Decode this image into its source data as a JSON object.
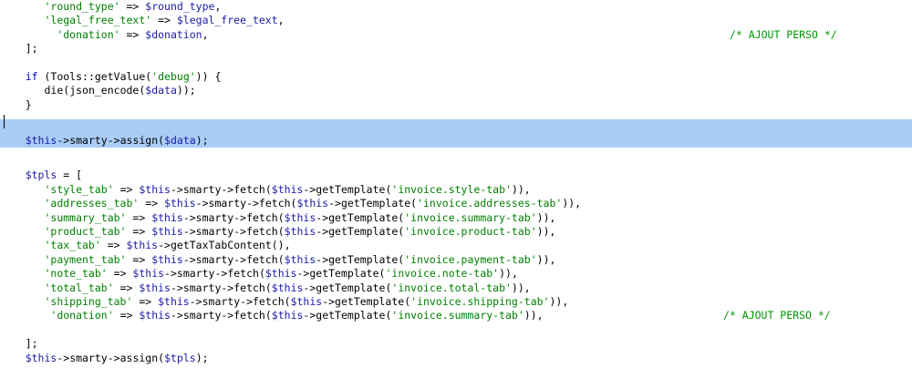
{
  "editor": {
    "lines": [
      {
        "indent": "       ",
        "parts": [
          [
            "str",
            "'round_type'"
          ],
          [
            "op",
            " => "
          ],
          [
            "var",
            "$round_type"
          ],
          [
            "op",
            ","
          ]
        ]
      },
      {
        "indent": "       ",
        "parts": [
          [
            "str",
            "'legal_free_text'"
          ],
          [
            "op",
            " => "
          ],
          [
            "var",
            "$legal_free_text"
          ],
          [
            "op",
            ","
          ]
        ]
      },
      {
        "indent": "         ",
        "parts": [
          [
            "str",
            "'donation'"
          ],
          [
            "op",
            " => "
          ],
          [
            "var",
            "$donation"
          ],
          [
            "op",
            ","
          ]
        ]
      },
      {
        "indent": "    ",
        "parts": [
          [
            "op",
            "];"
          ]
        ]
      },
      {
        "indent": "",
        "parts": []
      },
      {
        "indent": "    ",
        "parts": [
          [
            "kw",
            "if"
          ],
          [
            "op",
            " (Tools::"
          ],
          [
            "fn",
            "getValue"
          ],
          [
            "op",
            "("
          ],
          [
            "str",
            "'debug'"
          ],
          [
            "op",
            ")) {"
          ]
        ]
      },
      {
        "indent": "       ",
        "parts": [
          [
            "fn",
            "die"
          ],
          [
            "op",
            "("
          ],
          [
            "fn",
            "json_encode"
          ],
          [
            "op",
            "("
          ],
          [
            "var",
            "$data"
          ],
          [
            "op",
            "));"
          ]
        ]
      },
      {
        "indent": "    ",
        "parts": [
          [
            "op",
            "}"
          ]
        ]
      },
      {
        "indent": "",
        "parts": []
      },
      {
        "indent": "    ",
        "parts": [
          [
            "var",
            "$this"
          ],
          [
            "op",
            "->"
          ],
          [
            "fn",
            "smarty"
          ],
          [
            "op",
            "->"
          ],
          [
            "fn",
            "assign"
          ],
          [
            "op",
            "("
          ],
          [
            "var",
            "$data"
          ],
          [
            "op",
            ");"
          ]
        ],
        "selected": true
      },
      {
        "indent": "",
        "parts": []
      },
      {
        "indent": "    ",
        "parts": [
          [
            "var",
            "$tpls"
          ],
          [
            "op",
            " = ["
          ]
        ]
      },
      {
        "indent": "       ",
        "parts": [
          [
            "str",
            "'style_tab'"
          ],
          [
            "op",
            " => "
          ],
          [
            "var",
            "$this"
          ],
          [
            "op",
            "->"
          ],
          [
            "fn",
            "smarty"
          ],
          [
            "op",
            "->"
          ],
          [
            "fn",
            "fetch"
          ],
          [
            "op",
            "("
          ],
          [
            "var",
            "$this"
          ],
          [
            "op",
            "->"
          ],
          [
            "fn",
            "getTemplate"
          ],
          [
            "op",
            "("
          ],
          [
            "str",
            "'invoice.style-tab'"
          ],
          [
            "op",
            ")),"
          ]
        ]
      },
      {
        "indent": "       ",
        "parts": [
          [
            "str",
            "'addresses_tab'"
          ],
          [
            "op",
            " => "
          ],
          [
            "var",
            "$this"
          ],
          [
            "op",
            "->"
          ],
          [
            "fn",
            "smarty"
          ],
          [
            "op",
            "->"
          ],
          [
            "fn",
            "fetch"
          ],
          [
            "op",
            "("
          ],
          [
            "var",
            "$this"
          ],
          [
            "op",
            "->"
          ],
          [
            "fn",
            "getTemplate"
          ],
          [
            "op",
            "("
          ],
          [
            "str",
            "'invoice.addresses-tab'"
          ],
          [
            "op",
            ")),"
          ]
        ]
      },
      {
        "indent": "       ",
        "parts": [
          [
            "str",
            "'summary_tab'"
          ],
          [
            "op",
            " => "
          ],
          [
            "var",
            "$this"
          ],
          [
            "op",
            "->"
          ],
          [
            "fn",
            "smarty"
          ],
          [
            "op",
            "->"
          ],
          [
            "fn",
            "fetch"
          ],
          [
            "op",
            "("
          ],
          [
            "var",
            "$this"
          ],
          [
            "op",
            "->"
          ],
          [
            "fn",
            "getTemplate"
          ],
          [
            "op",
            "("
          ],
          [
            "str",
            "'invoice.summary-tab'"
          ],
          [
            "op",
            ")),"
          ]
        ]
      },
      {
        "indent": "       ",
        "parts": [
          [
            "str",
            "'product_tab'"
          ],
          [
            "op",
            " => "
          ],
          [
            "var",
            "$this"
          ],
          [
            "op",
            "->"
          ],
          [
            "fn",
            "smarty"
          ],
          [
            "op",
            "->"
          ],
          [
            "fn",
            "fetch"
          ],
          [
            "op",
            "("
          ],
          [
            "var",
            "$this"
          ],
          [
            "op",
            "->"
          ],
          [
            "fn",
            "getTemplate"
          ],
          [
            "op",
            "("
          ],
          [
            "str",
            "'invoice.product-tab'"
          ],
          [
            "op",
            ")),"
          ]
        ]
      },
      {
        "indent": "       ",
        "parts": [
          [
            "str",
            "'tax_tab'"
          ],
          [
            "op",
            " => "
          ],
          [
            "var",
            "$this"
          ],
          [
            "op",
            "->"
          ],
          [
            "fn",
            "getTaxTabContent"
          ],
          [
            "op",
            "(),"
          ]
        ]
      },
      {
        "indent": "       ",
        "parts": [
          [
            "str",
            "'payment_tab'"
          ],
          [
            "op",
            " => "
          ],
          [
            "var",
            "$this"
          ],
          [
            "op",
            "->"
          ],
          [
            "fn",
            "smarty"
          ],
          [
            "op",
            "->"
          ],
          [
            "fn",
            "fetch"
          ],
          [
            "op",
            "("
          ],
          [
            "var",
            "$this"
          ],
          [
            "op",
            "->"
          ],
          [
            "fn",
            "getTemplate"
          ],
          [
            "op",
            "("
          ],
          [
            "str",
            "'invoice.payment-tab'"
          ],
          [
            "op",
            ")),"
          ]
        ]
      },
      {
        "indent": "       ",
        "parts": [
          [
            "str",
            "'note_tab'"
          ],
          [
            "op",
            " => "
          ],
          [
            "var",
            "$this"
          ],
          [
            "op",
            "->"
          ],
          [
            "fn",
            "smarty"
          ],
          [
            "op",
            "->"
          ],
          [
            "fn",
            "fetch"
          ],
          [
            "op",
            "("
          ],
          [
            "var",
            "$this"
          ],
          [
            "op",
            "->"
          ],
          [
            "fn",
            "getTemplate"
          ],
          [
            "op",
            "("
          ],
          [
            "str",
            "'invoice.note-tab'"
          ],
          [
            "op",
            ")),"
          ]
        ]
      },
      {
        "indent": "       ",
        "parts": [
          [
            "str",
            "'total_tab'"
          ],
          [
            "op",
            " => "
          ],
          [
            "var",
            "$this"
          ],
          [
            "op",
            "->"
          ],
          [
            "fn",
            "smarty"
          ],
          [
            "op",
            "->"
          ],
          [
            "fn",
            "fetch"
          ],
          [
            "op",
            "("
          ],
          [
            "var",
            "$this"
          ],
          [
            "op",
            "->"
          ],
          [
            "fn",
            "getTemplate"
          ],
          [
            "op",
            "("
          ],
          [
            "str",
            "'invoice.total-tab'"
          ],
          [
            "op",
            ")),"
          ]
        ]
      },
      {
        "indent": "       ",
        "parts": [
          [
            "str",
            "'shipping_tab'"
          ],
          [
            "op",
            " => "
          ],
          [
            "var",
            "$this"
          ],
          [
            "op",
            "->"
          ],
          [
            "fn",
            "smarty"
          ],
          [
            "op",
            "->"
          ],
          [
            "fn",
            "fetch"
          ],
          [
            "op",
            "("
          ],
          [
            "var",
            "$this"
          ],
          [
            "op",
            "->"
          ],
          [
            "fn",
            "getTemplate"
          ],
          [
            "op",
            "("
          ],
          [
            "str",
            "'invoice.shipping-tab'"
          ],
          [
            "op",
            ")),"
          ]
        ]
      },
      {
        "indent": "        ",
        "parts": [
          [
            "str",
            "'donation'"
          ],
          [
            "op",
            " => "
          ],
          [
            "var",
            "$this"
          ],
          [
            "op",
            "->"
          ],
          [
            "fn",
            "smarty"
          ],
          [
            "op",
            "->"
          ],
          [
            "fn",
            "fetch"
          ],
          [
            "op",
            "("
          ],
          [
            "var",
            "$this"
          ],
          [
            "op",
            "->"
          ],
          [
            "fn",
            "getTemplate"
          ],
          [
            "op",
            "("
          ],
          [
            "str",
            "'invoice.summary-tab'"
          ],
          [
            "op",
            ")),"
          ]
        ]
      },
      {
        "indent": "",
        "parts": []
      },
      {
        "indent": "    ",
        "parts": [
          [
            "op",
            "];"
          ]
        ]
      },
      {
        "indent": "    ",
        "parts": [
          [
            "var",
            "$this"
          ],
          [
            "op",
            "->"
          ],
          [
            "fn",
            "smarty"
          ],
          [
            "op",
            "->"
          ],
          [
            "fn",
            "assign"
          ],
          [
            "op",
            "("
          ],
          [
            "var",
            "$tpls"
          ],
          [
            "op",
            ");"
          ]
        ]
      }
    ],
    "comments": [
      {
        "line": 2,
        "text": "/* AJOUT PERSO */"
      },
      {
        "line": 21,
        "text": "/* AJOUT PERSO */"
      }
    ]
  },
  "colors": {
    "selection": "#a8cdf7",
    "string": "#008000",
    "variable": "#1a1aa6",
    "keyword": "#0000c0",
    "comment": "#009600"
  }
}
